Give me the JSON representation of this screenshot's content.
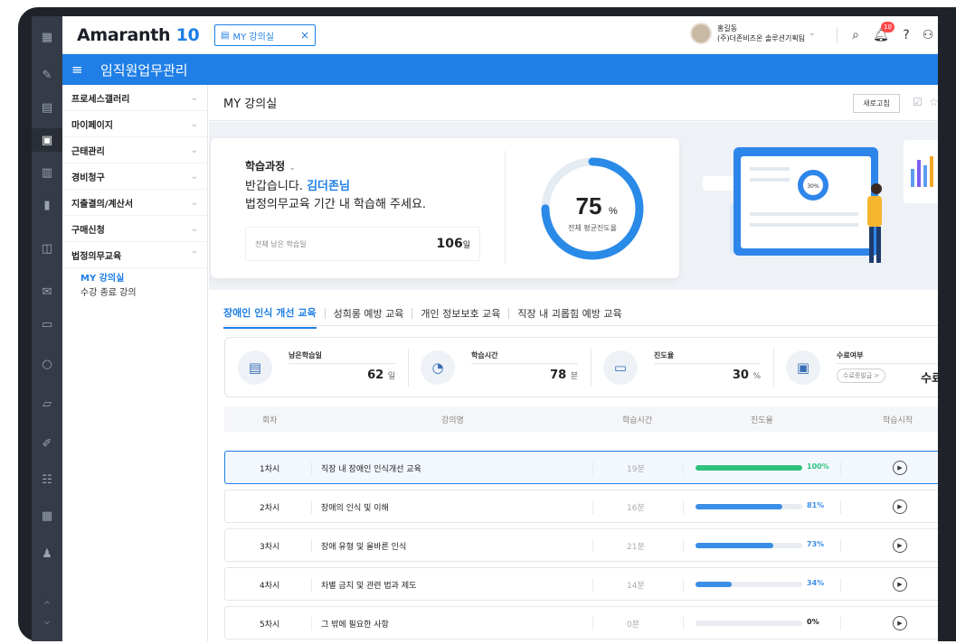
{
  "app": {
    "logo_text": "Amaranth",
    "logo_num": "10"
  },
  "tab": {
    "label": "MY 강의실",
    "close": "×",
    "tab_icon": "calendar-icon"
  },
  "user": {
    "name": "홍길동",
    "org": "(주)더존비즈온 솔루션기획팀",
    "notifications": "10"
  },
  "module_title": "임직원업무관리",
  "rail_icons": [
    "apps-icon",
    "pen-icon",
    "calendar-icon",
    "edu-icon",
    "calendar-check-icon",
    "document-icon",
    "kiss-icon",
    "mail-icon",
    "monitor-user-icon",
    "board-icon",
    "screen-settings-icon",
    "edit-icon",
    "org-icon",
    "calculator-icon",
    "people-icon"
  ],
  "menu": {
    "items": [
      {
        "label": "프로세스갤러리"
      },
      {
        "label": "마이페이지"
      },
      {
        "label": "근태관리"
      },
      {
        "label": "경비청구"
      },
      {
        "label": "지출결의/계산서"
      },
      {
        "label": "구매신청"
      },
      {
        "label": "법정의무교육"
      }
    ],
    "sub_items": [
      {
        "label": "MY 강의실"
      },
      {
        "label": "수강 종료 강의"
      }
    ]
  },
  "page": {
    "title": "MY 강의실",
    "refresh_label": "새로고침"
  },
  "hero": {
    "section_title": "학습과정",
    "greeting": "반갑습니다.",
    "user_name": "김더존님",
    "message": "법정의무교육 기간 내 학습해 주세요.",
    "remaining_label": "전체 남은 학습일",
    "remaining_value": "106",
    "remaining_unit": "일",
    "progress_value": "75",
    "progress_unit": "%",
    "progress_label": "전체 평균진도율",
    "progress_fraction": 0.75,
    "illus_badge": "30%"
  },
  "course_tabs": [
    {
      "label": "장애인 인식 개선 교육"
    },
    {
      "label": "성희롱 예방 교육"
    },
    {
      "label": "개인 정보보호 교육"
    },
    {
      "label": "직장 내 괴롭힘 예방 교육"
    }
  ],
  "stats": [
    {
      "label": "남은학습일",
      "value": "62",
      "unit": "일",
      "icon": "calendar-clock-icon"
    },
    {
      "label": "학습시간",
      "value": "78",
      "unit": "분",
      "icon": "clock-icon"
    },
    {
      "label": "진도율",
      "value": "30",
      "unit": "%",
      "icon": "progress-icon"
    },
    {
      "label": "수료여부",
      "value": "수료",
      "button": "수료증발급 >",
      "icon": "certificate-icon"
    }
  ],
  "table": {
    "headers": [
      "회차",
      "강의명",
      "학습시간",
      "진도율",
      "학습시작"
    ],
    "rows": [
      {
        "no": "1차시",
        "name": "직장 내 장애인 인식개선 교육",
        "time": "19분",
        "pct": "100%",
        "fill": 1.0
      },
      {
        "no": "2차시",
        "name": "장애의 인식 및 이해",
        "time": "16분",
        "pct": "81%",
        "fill": 0.81
      },
      {
        "no": "3차시",
        "name": "장애 유형 및 올바른 인식",
        "time": "21분",
        "pct": "73%",
        "fill": 0.73
      },
      {
        "no": "4차시",
        "name": "차별 금지 및 관련 법과 제도",
        "time": "14분",
        "pct": "34%",
        "fill": 0.34
      },
      {
        "no": "5차시",
        "name": "그 밖에 필요한 사항",
        "time": "0분",
        "pct": "0%",
        "fill": 0.0
      }
    ]
  },
  "colors": {
    "accent": "#1f7fe6",
    "complete": "#2ec27e",
    "progress": "#3a8ee6"
  }
}
